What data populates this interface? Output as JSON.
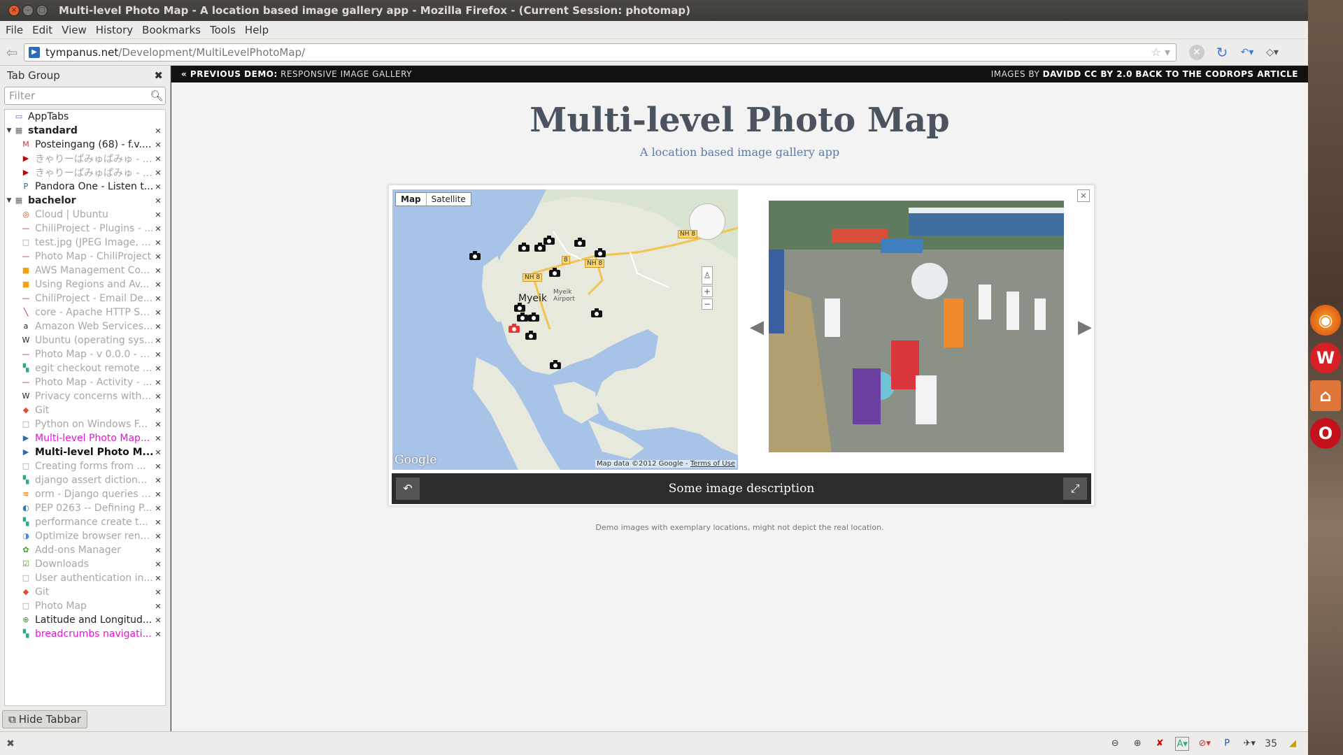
{
  "window": {
    "title": "Multi-level Photo Map - A location based image gallery app - Mozilla Firefox - (Current Session: photomap)"
  },
  "menu": [
    "File",
    "Edit",
    "View",
    "History",
    "Bookmarks",
    "Tools",
    "Help"
  ],
  "url": {
    "host": "tympanus.net",
    "path": "/Development/MultiLevelPhotoMap/"
  },
  "sidebar": {
    "title": "Tab Group",
    "filter_placeholder": "Filter",
    "hide_label": "Hide Tabbar",
    "rows": [
      {
        "kind": "apps",
        "label": "AppTabs",
        "icon": "apptabs-icon",
        "glyph": "▭",
        "color": "#4a6fa5"
      },
      {
        "kind": "group",
        "label": "standard",
        "icon": "group-icon",
        "glyph": "▦",
        "color": "#666"
      },
      {
        "kind": "tab",
        "label": "Posteingang (68) - f.v....",
        "icon": "gmail-icon",
        "glyph": "M",
        "color": "#c33",
        "state": "normal"
      },
      {
        "kind": "tab",
        "label": "きゃりーぱみゅぱみゅ - ...",
        "icon": "youtube-icon",
        "glyph": "▶",
        "color": "#c00",
        "state": "dim"
      },
      {
        "kind": "tab",
        "label": "きゃりーぱみゅぱみゅ - P...",
        "icon": "youtube-icon",
        "glyph": "▶",
        "color": "#c00",
        "state": "dim"
      },
      {
        "kind": "tab",
        "label": "Pandora One - Listen t...",
        "icon": "pandora-icon",
        "glyph": "P",
        "color": "#2c5a9c",
        "state": "normal"
      },
      {
        "kind": "group",
        "label": "bachelor",
        "icon": "group-icon",
        "glyph": "▦",
        "color": "#666"
      },
      {
        "kind": "tab",
        "label": "Cloud | Ubuntu",
        "icon": "ubuntu-icon",
        "glyph": "◎",
        "color": "#dd4814",
        "state": "dim"
      },
      {
        "kind": "tab",
        "label": "ChiliProject - Plugins - ...",
        "icon": "chili-icon",
        "glyph": "—",
        "color": "#c22",
        "state": "dim"
      },
      {
        "kind": "tab",
        "label": "test.jpg (JPEG Image, ...",
        "icon": "blank-page-icon",
        "glyph": "□",
        "color": "#999",
        "state": "dim"
      },
      {
        "kind": "tab",
        "label": "Photo Map - ChiliProject",
        "icon": "chili-icon",
        "glyph": "—",
        "color": "#c22",
        "state": "dim"
      },
      {
        "kind": "tab",
        "label": "AWS Management Co...",
        "icon": "aws-icon",
        "glyph": "■",
        "color": "#f0a30a",
        "state": "dim"
      },
      {
        "kind": "tab",
        "label": "Using Regions and Av...",
        "icon": "aws-icon",
        "glyph": "■",
        "color": "#f0a30a",
        "state": "dim"
      },
      {
        "kind": "tab",
        "label": "ChiliProject - Email De...",
        "icon": "chili-icon",
        "glyph": "—",
        "color": "#c22",
        "state": "dim"
      },
      {
        "kind": "tab",
        "label": "core - Apache HTTP Se...",
        "icon": "apache-icon",
        "glyph": "╲",
        "color": "#a31f5f",
        "state": "dim"
      },
      {
        "kind": "tab",
        "label": "Amazon Web Services...",
        "icon": "amazon-icon",
        "glyph": "a",
        "color": "#222",
        "state": "dim"
      },
      {
        "kind": "tab",
        "label": "Ubuntu (operating sys...",
        "icon": "wikipedia-icon",
        "glyph": "W",
        "color": "#222",
        "state": "dim"
      },
      {
        "kind": "tab",
        "label": "Photo Map - v 0.0.0 - C...",
        "icon": "chili-icon",
        "glyph": "—",
        "color": "#c22",
        "state": "dim"
      },
      {
        "kind": "tab",
        "label": "egit checkout remote ...",
        "icon": "google-icon",
        "glyph": "▚",
        "color": "#3a7",
        "state": "dim"
      },
      {
        "kind": "tab",
        "label": "Photo Map - Activity - ...",
        "icon": "chili-icon",
        "glyph": "—",
        "color": "#c22",
        "state": "dim"
      },
      {
        "kind": "tab",
        "label": "Privacy concerns with ...",
        "icon": "wikipedia-icon",
        "glyph": "W",
        "color": "#222",
        "state": "dim"
      },
      {
        "kind": "tab",
        "label": "Git",
        "icon": "git-icon",
        "glyph": "◆",
        "color": "#e44c30",
        "state": "dim"
      },
      {
        "kind": "tab",
        "label": "Python on Windows F...",
        "icon": "blank-page-icon",
        "glyph": "□",
        "color": "#999",
        "state": "dim"
      },
      {
        "kind": "tab",
        "label": "Multi-level Photo Map...",
        "icon": "site-icon",
        "glyph": "▶",
        "color": "#2d6bb5",
        "state": "pink"
      },
      {
        "kind": "tab",
        "label": "Multi-level Photo M...",
        "icon": "site-icon",
        "glyph": "▶",
        "color": "#2d6bb5",
        "state": "sel"
      },
      {
        "kind": "tab",
        "label": "Creating forms from ...",
        "icon": "blank-page-icon",
        "glyph": "□",
        "color": "#999",
        "state": "dim"
      },
      {
        "kind": "tab",
        "label": "django assert diction...",
        "icon": "google-icon",
        "glyph": "▚",
        "color": "#3a7",
        "state": "dim"
      },
      {
        "kind": "tab",
        "label": "orm - Django queries - ...",
        "icon": "stackoverflow-icon",
        "glyph": "≡",
        "color": "#f48024",
        "state": "dim"
      },
      {
        "kind": "tab",
        "label": "PEP 0263 -- Defining P...",
        "icon": "python-icon",
        "glyph": "◐",
        "color": "#3776ab",
        "state": "dim"
      },
      {
        "kind": "tab",
        "label": "performance create t...",
        "icon": "google-icon",
        "glyph": "▚",
        "color": "#3a7",
        "state": "dim"
      },
      {
        "kind": "tab",
        "label": "Optimize browser ren...",
        "icon": "pagespeed-icon",
        "glyph": "◑",
        "color": "#4285f4",
        "state": "dim"
      },
      {
        "kind": "tab",
        "label": "Add-ons Manager",
        "icon": "addons-icon",
        "glyph": "✿",
        "color": "#4a9c2d",
        "state": "dim"
      },
      {
        "kind": "tab",
        "label": "Downloads",
        "icon": "downloads-icon",
        "glyph": "☑",
        "color": "#4a9c2d",
        "state": "dim"
      },
      {
        "kind": "tab",
        "label": "User authentication in...",
        "icon": "blank-page-icon",
        "glyph": "□",
        "color": "#999",
        "state": "dim"
      },
      {
        "kind": "tab",
        "label": "Git",
        "icon": "git-icon",
        "glyph": "◆",
        "color": "#e44c30",
        "state": "dim"
      },
      {
        "kind": "tab",
        "label": "Photo Map",
        "icon": "blank-page-icon",
        "glyph": "□",
        "color": "#999",
        "state": "dim"
      },
      {
        "kind": "tab",
        "label": "Latitude and Longitud...",
        "icon": "globe-icon",
        "glyph": "⊕",
        "color": "#3a8a3a",
        "state": "normal"
      },
      {
        "kind": "tab",
        "label": "breadcrumbs navigati...",
        "icon": "google-icon",
        "glyph": "▚",
        "color": "#3a7",
        "state": "pink"
      }
    ]
  },
  "page": {
    "prev_prefix": "« PREVIOUS DEMO:",
    "prev_name": "RESPONSIVE IMAGE GALLERY",
    "images_by_prefix": "IMAGES BY",
    "images_by_name": "DAVIDD",
    "license": "CC BY 2.0",
    "back_link": "BACK TO THE CODROPS ARTICLE",
    "title": "Multi-level Photo Map",
    "subtitle": "A location based image gallery app",
    "caption": "Some image description",
    "note": "Demo images with exemplary locations, might not depict the real location."
  },
  "map": {
    "btn_map": "Map",
    "btn_satellite": "Satellite",
    "city": "Myeik",
    "airport": "Myeik Airport",
    "road_nh8": "NH 8",
    "road_8": "8",
    "google": "Google",
    "attribution": "Map data ©2012 Google -",
    "terms": "Terms of Use"
  },
  "status": {
    "count": "35"
  },
  "colors": {
    "accent_pink": "#e415d4",
    "title": "#4a5460",
    "subtitle": "#5c7aa5"
  }
}
